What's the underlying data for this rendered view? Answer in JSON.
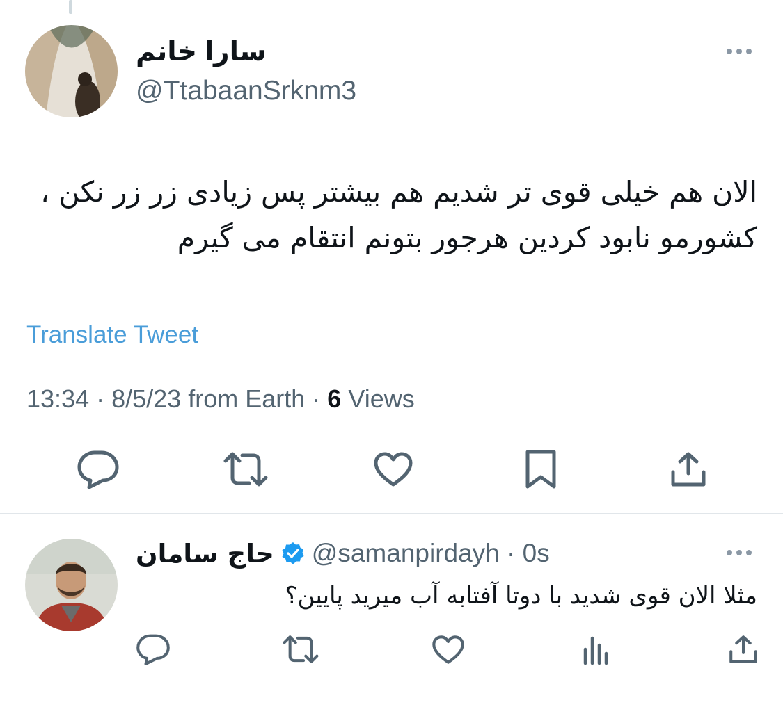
{
  "tweet": {
    "author_name": "سارا خانم",
    "author_handle": "@TtabaanSrknm3",
    "text": "الان هم خیلی قوی تر شدیم هم بیشتر پس زیادی زر زر نکن ، کشورمو نابود کردین هرجور بتونم انتقام می گیرم",
    "translate_label": "Translate Tweet",
    "meta": {
      "time": "13:34",
      "date": "8/5/23",
      "source": "from Earth",
      "views_count": "6",
      "views_label": "Views"
    },
    "actions": [
      "reply-icon",
      "retweet-icon",
      "like-icon",
      "bookmark-icon",
      "share-icon"
    ]
  },
  "reply": {
    "author_name": "حاج سامان",
    "verified": true,
    "author_handle": "@samanpirdayh",
    "time": "0s",
    "text": "مثلا الان قوی شدید با دوتا آفتابه آب میرید پایین؟",
    "actions": [
      "reply-icon",
      "retweet-icon",
      "like-icon",
      "analytics-icon",
      "share-icon"
    ]
  },
  "colors": {
    "text": "#0f1419",
    "secondary": "#536471",
    "link": "#4a9dd9",
    "verified": "#1d9bf0",
    "divider": "#e1e6ea"
  }
}
